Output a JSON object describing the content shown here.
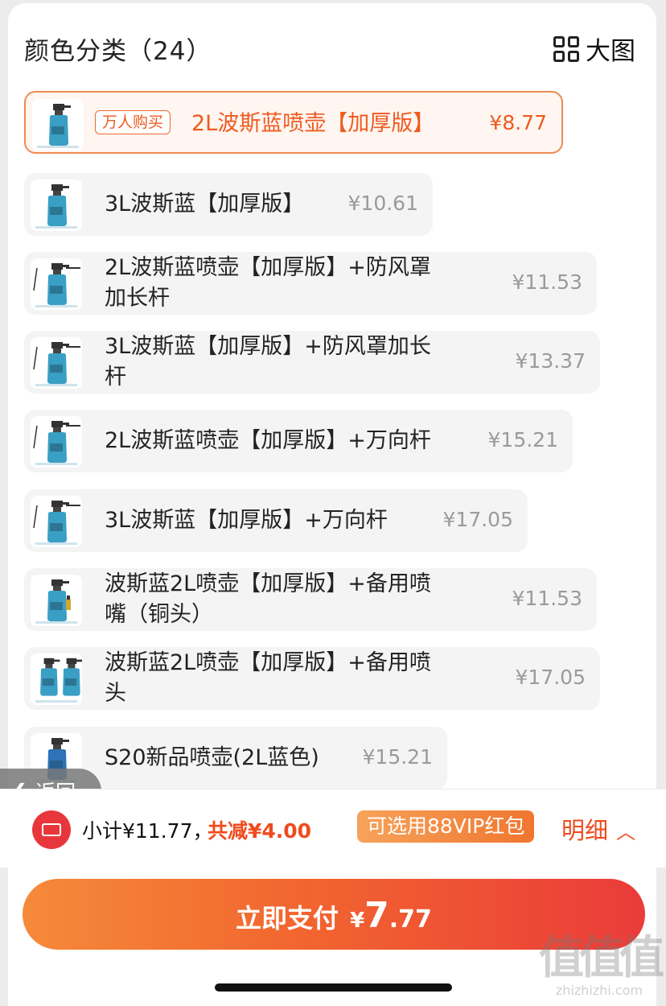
{
  "header": {
    "title": "颜色分类（24）",
    "big_view_label": "大图"
  },
  "options": [
    {
      "badge": "万人购买",
      "name_lines": [
        "2L波斯蓝喷壶【加厚版】"
      ],
      "price": "¥8.77",
      "selected": true,
      "thumb": "sprayer-2l"
    },
    {
      "name_lines": [
        "3L波斯蓝【加厚版】"
      ],
      "price": "¥10.61",
      "selected": false,
      "thumb": "sprayer-3l"
    },
    {
      "name_lines": [
        "2L波斯蓝喷壶【加厚版】+防风罩",
        "加长杆"
      ],
      "price": "¥11.53",
      "selected": false,
      "thumb": "sprayer-2l-rod"
    },
    {
      "name_lines": [
        "3L波斯蓝【加厚版】+防风罩加长",
        "杆"
      ],
      "price": "¥13.37",
      "selected": false,
      "thumb": "sprayer-3l-rod"
    },
    {
      "name_lines": [
        "2L波斯蓝喷壶【加厚版】+万向杆"
      ],
      "price": "¥15.21",
      "selected": false,
      "thumb": "sprayer-2l-swivel"
    },
    {
      "name_lines": [
        "3L波斯蓝【加厚版】+万向杆"
      ],
      "price": "¥17.05",
      "selected": false,
      "thumb": "sprayer-3l-swivel"
    },
    {
      "name_lines": [
        "波斯蓝2L喷壶【加厚版】+备用喷",
        "嘴（铜头）"
      ],
      "price": "¥11.53",
      "selected": false,
      "thumb": "sprayer-2l-nozzle"
    },
    {
      "name_lines": [
        "波斯蓝2L喷壶【加厚版】+备用喷",
        "头"
      ],
      "price": "¥17.05",
      "selected": false,
      "thumb": "sprayer-2l-spare"
    },
    {
      "name_lines": [
        "S20新品喷壶(2L蓝色)"
      ],
      "price": "¥15.21",
      "selected": false,
      "thumb": "sprayer-s20"
    }
  ],
  "back_button": {
    "label": "返回"
  },
  "summary": {
    "subtotal": "小计¥11.77，",
    "saving": "共减¥4.00",
    "vip_badge": "可选用88VIP红包",
    "detail_label": "明细"
  },
  "pay": {
    "label": "立即支付",
    "currency": "¥",
    "amount_int": "7",
    "amount_dec": ".77"
  },
  "watermark": {
    "main": "值值值",
    "sub": "zhizhizhi.com"
  },
  "colors": {
    "accent": "#ef5a1f",
    "price_gray": "#9a9a9a",
    "option_bg": "#f4f4f4",
    "pay_gradient_start": "#f58a3a",
    "pay_gradient_end": "#ea3b3a",
    "sprayer_blue": "#3a9fc4"
  }
}
